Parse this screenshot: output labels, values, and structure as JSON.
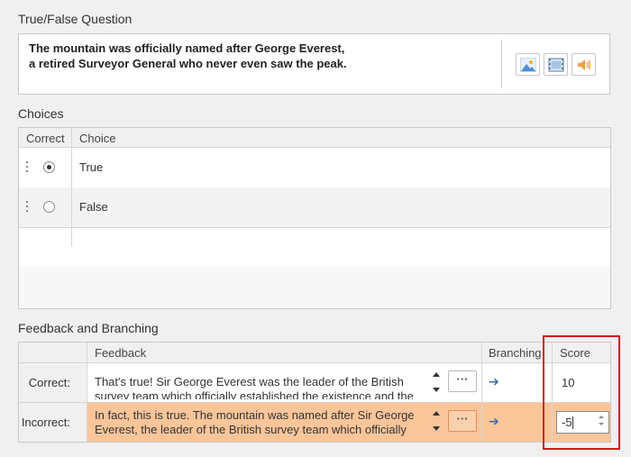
{
  "question": {
    "section_title": "True/False Question",
    "text": "The mountain was officially named after George Everest,\na retired Surveyor General who never even saw the peak."
  },
  "media_buttons": [
    {
      "icon": "image-icon"
    },
    {
      "icon": "video-icon"
    },
    {
      "icon": "audio-icon"
    }
  ],
  "choices": {
    "section_title": "Choices",
    "columns": [
      "Correct",
      "Choice"
    ],
    "rows": [
      {
        "label": "True",
        "correct": true
      },
      {
        "label": "False",
        "correct": false
      }
    ]
  },
  "feedback": {
    "section_title": "Feedback and Branching",
    "columns": [
      "Feedback",
      "Branching",
      "Score"
    ],
    "rows": [
      {
        "label": "Correct:",
        "text": "That's true! Sir George Everest was the leader of the British survey team which officially established the existence and the",
        "ellipsis": "···",
        "branch": "➔",
        "score": "10"
      },
      {
        "label": "Incorrect:",
        "text": "In fact, this is true. The mountain was named after Sir George Everest, the leader of the British survey team which officially",
        "ellipsis": "···",
        "branch": "➔",
        "score": "-5"
      }
    ]
  },
  "colors": {
    "selected_row": "#fbc59a",
    "highlight": "#d11a1a",
    "branch_arrow": "#3a6ea5"
  }
}
